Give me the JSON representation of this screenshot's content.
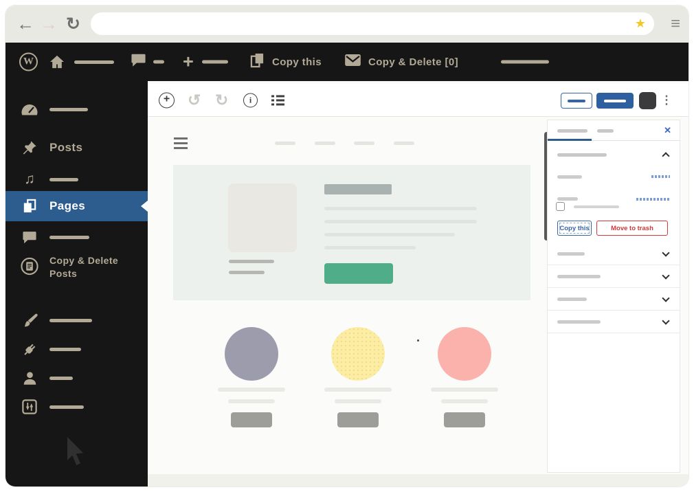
{
  "browser_chrome": {
    "back_icon": "←",
    "forward_icon": "→",
    "refresh_icon": "↻",
    "url_value": "",
    "bookmark_star_icon": "★",
    "menu_icon": "≡"
  },
  "admin_bar": {
    "wp_logo_letter": "W",
    "new_icon": "+",
    "copy_this_label": "Copy this",
    "copy_delete_label": "Copy & Delete [0]"
  },
  "sidebar": {
    "posts_label": "Posts",
    "pages_label": "Pages",
    "copy_delete_posts_label": "Copy & Delete Posts",
    "media_icon": "♫"
  },
  "editor_toolbar": {
    "add_icon": "+",
    "undo_icon": "↺",
    "redo_icon": "↻",
    "info_icon": "i",
    "kebab_icon": "⋮"
  },
  "settings_panel": {
    "close_icon": "✕",
    "copy_this_button": "Copy this",
    "move_to_trash_button": "Move to trash"
  },
  "colors": {
    "accent_blue": "#2d5d8e",
    "button_blue": "#2e5f9f",
    "link_blue": "#3565a9",
    "danger_red": "#d63638",
    "success_green": "#50ad8a",
    "bar_beige": "#b2aa96",
    "star_yellow": "#f0c929",
    "circle_purple": "#9c9cad",
    "circle_yellow": "#fceda3",
    "circle_pink": "#fbb2ac"
  }
}
